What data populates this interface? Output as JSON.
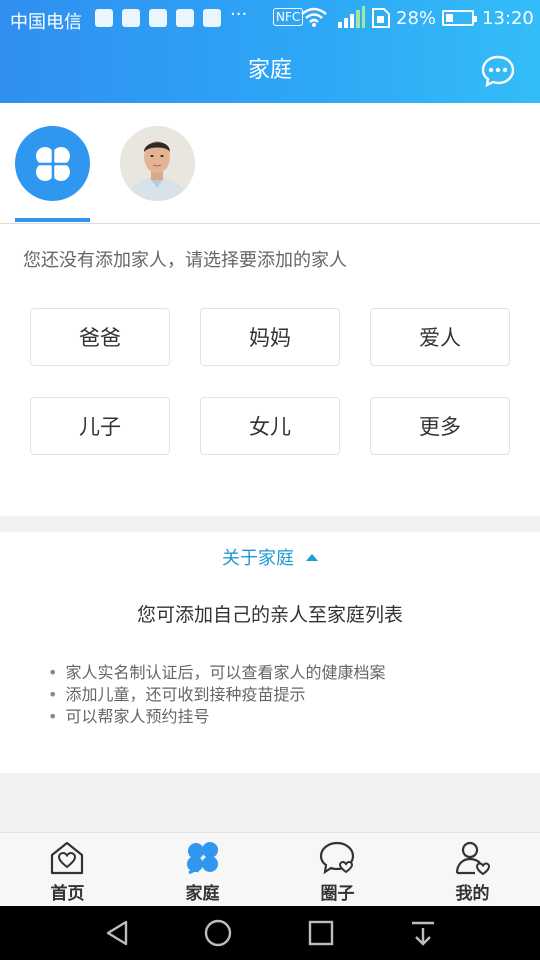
{
  "status_bar": {
    "carrier": "中国电信",
    "more": "···",
    "nfc": "NFC",
    "battery_percent": "28%",
    "battery_level": 0.28,
    "time": "13:20"
  },
  "header": {
    "title": "家庭"
  },
  "add_family": {
    "hint": "您还没有添加家人，请选择要添加的家人",
    "relations": [
      "爸爸",
      "妈妈",
      "爱人",
      "儿子",
      "女儿",
      "更多"
    ]
  },
  "about": {
    "toggle_label": "关于家庭",
    "subtitle": "您可添加自己的亲人至家庭列表",
    "bullets": [
      "家人实名制认证后，可以查看家人的健康档案",
      "添加儿童，还可收到接种疫苗提示",
      "可以帮家人预约挂号"
    ]
  },
  "bottom_nav": {
    "items": [
      {
        "label": "首页",
        "icon": "home-heart-icon"
      },
      {
        "label": "家庭",
        "icon": "family-clover-icon",
        "active": true
      },
      {
        "label": "圈子",
        "icon": "chat-heart-icon"
      },
      {
        "label": "我的",
        "icon": "profile-heart-icon"
      }
    ]
  },
  "colors": {
    "brand": "#2f97ef",
    "link": "#1e9ad6"
  }
}
